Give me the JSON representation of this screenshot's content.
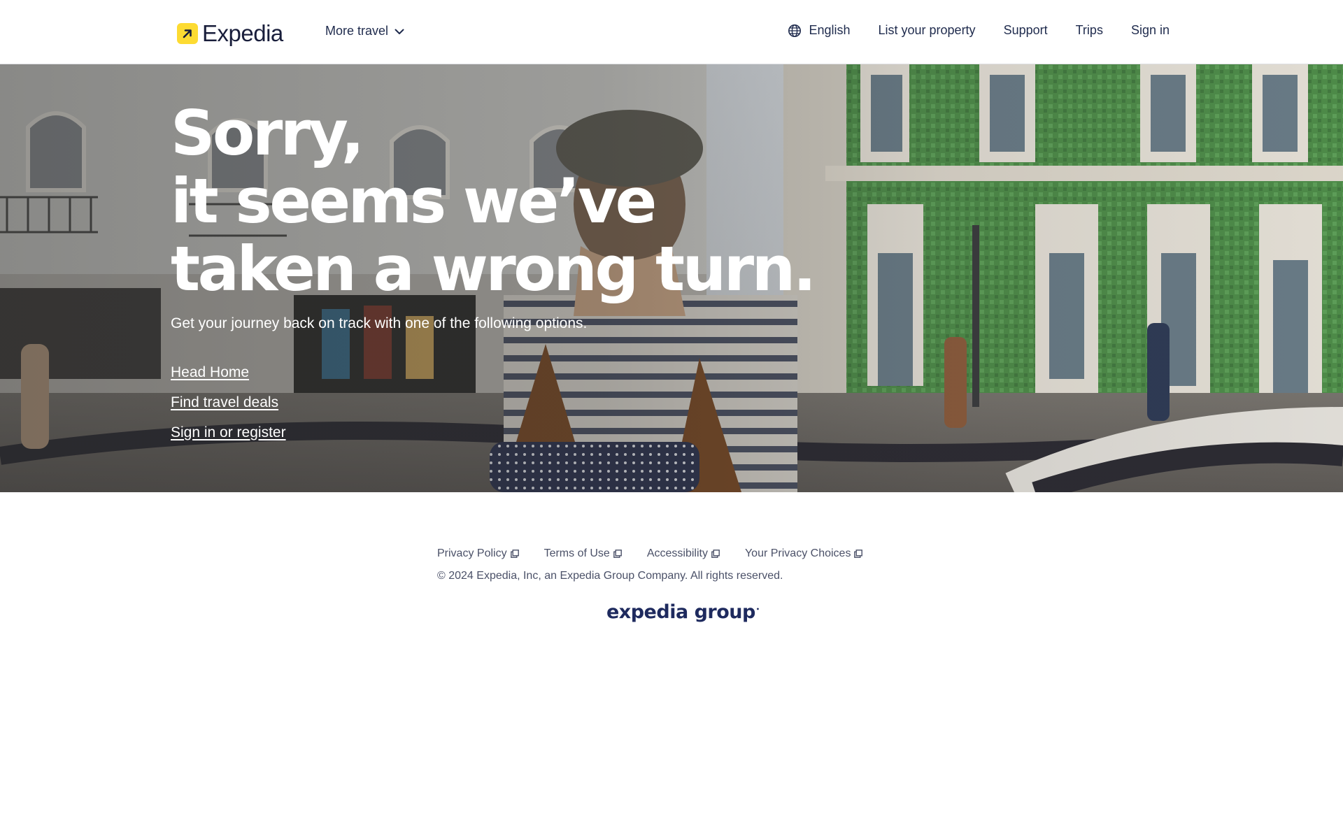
{
  "header": {
    "logo_text": "Expedia",
    "more_travel": "More travel",
    "nav": {
      "language": "English",
      "list_property": "List your property",
      "support": "Support",
      "trips": "Trips",
      "sign_in": "Sign in"
    }
  },
  "hero": {
    "headline_line1": "Sorry,",
    "headline_line2": "it seems we’ve",
    "headline_line3": "taken a wrong turn.",
    "subtext": "Get your journey back on track with one of the following options.",
    "links": {
      "head_home": "Head Home",
      "travel_deals": "Find travel deals",
      "sign_in_register": "Sign in or register"
    }
  },
  "footer": {
    "links": {
      "privacy_policy": "Privacy Policy",
      "terms_of_use": "Terms of Use",
      "accessibility": "Accessibility",
      "privacy_choices": "Your Privacy Choices"
    },
    "copyright": "© 2024 Expedia, Inc, an Expedia Group Company. All rights reserved.",
    "group_logo_text": "expedia group"
  },
  "colors": {
    "brand_yellow": "#fddb32",
    "navy": "#191e3b",
    "group_logo": "#1e2a5e"
  },
  "icons": {
    "logo_mark": "arrow-up-right-icon",
    "dropdown": "chevron-down-icon",
    "language": "globe-icon",
    "external": "external-link-icon"
  }
}
